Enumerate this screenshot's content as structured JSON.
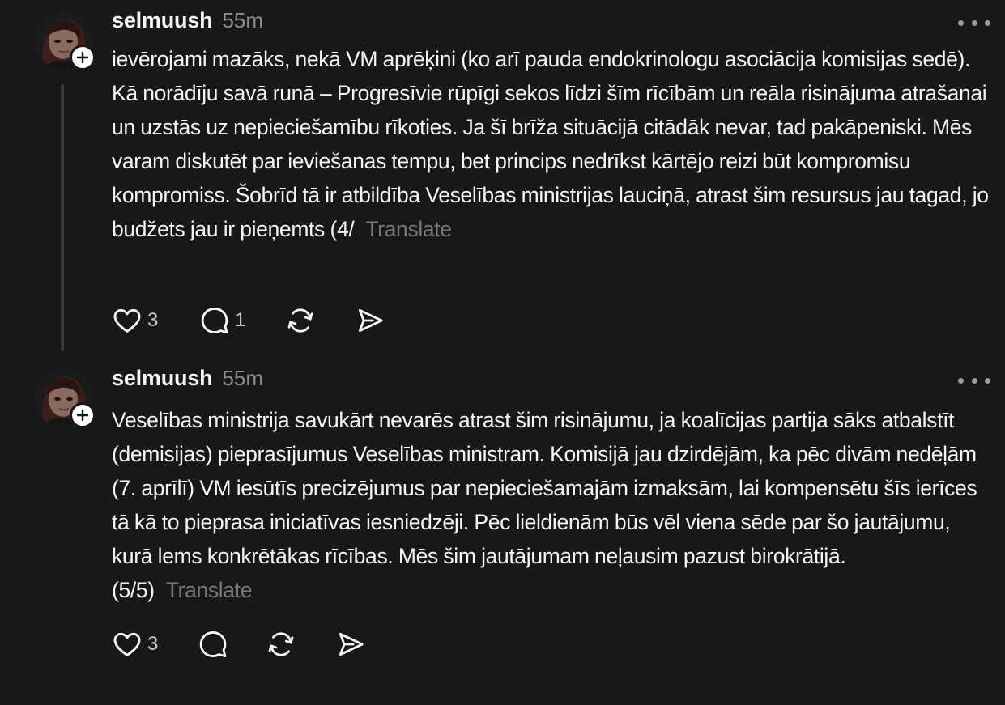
{
  "theme": {
    "background": "#181818",
    "text": "#f3f5f7",
    "muted": "#8a8a8a",
    "translate": "#777777"
  },
  "posts": [
    {
      "username": "selmuush",
      "time": "55m",
      "text": "ievērojami mazāks, nekā VM aprēķini (ko arī pauda endokrinologu asociācija komisijas sedē). Kā norādīju savā runā – Progresīvie rūpīgi sekos līdzi šīm rīcībām un reāla risinājuma atrašanai un uzstās uz nepieciešamību rīkoties. Ja šī brīža situācijā citādāk nevar, tad pakāpeniski. Mēs varam diskutēt par ieviešanas tempu, bet princips nedrīkst kārtējo reizi būt kompromisu kompromiss. Šobrīd tā ir atbildība Veselības ministrijas lauciņā, atrast šim resursus jau tagad, jo budžets jau ir pieņemts (4/",
      "translate_label": "Translate",
      "likes": "3",
      "replies": "1",
      "icons": [
        "heart-icon",
        "comment-icon",
        "repost-icon",
        "share-icon",
        "more-icon",
        "follow-plus-icon"
      ]
    },
    {
      "username": "selmuush",
      "time": "55m",
      "text": "Veselības ministrija savukārt nevarēs atrast šim risinājumu, ja koalīcijas partija sāks atbalstīt (demisijas) pieprasījumus Veselības ministram. Komisijā jau dzirdējām, ka pēc divām nedēļām (7. aprīlī) VM iesūtīs precizējumus par nepieciešamajām izmaksām, lai kompensētu šīs ierīces tā kā to pieprasa iniciatīvas iesniedzēji. Pēc lieldienām būs vēl viena sēde par šo jautājumu, kurā lems konkrētākas rīcības. Mēs šim jautājumam neļausim pazust birokrātijā. (5/5)",
      "translate_label": "Translate",
      "likes": "3",
      "replies": "",
      "icons": [
        "heart-icon",
        "comment-icon",
        "repost-icon",
        "share-icon",
        "more-icon",
        "follow-plus-icon"
      ]
    }
  ]
}
